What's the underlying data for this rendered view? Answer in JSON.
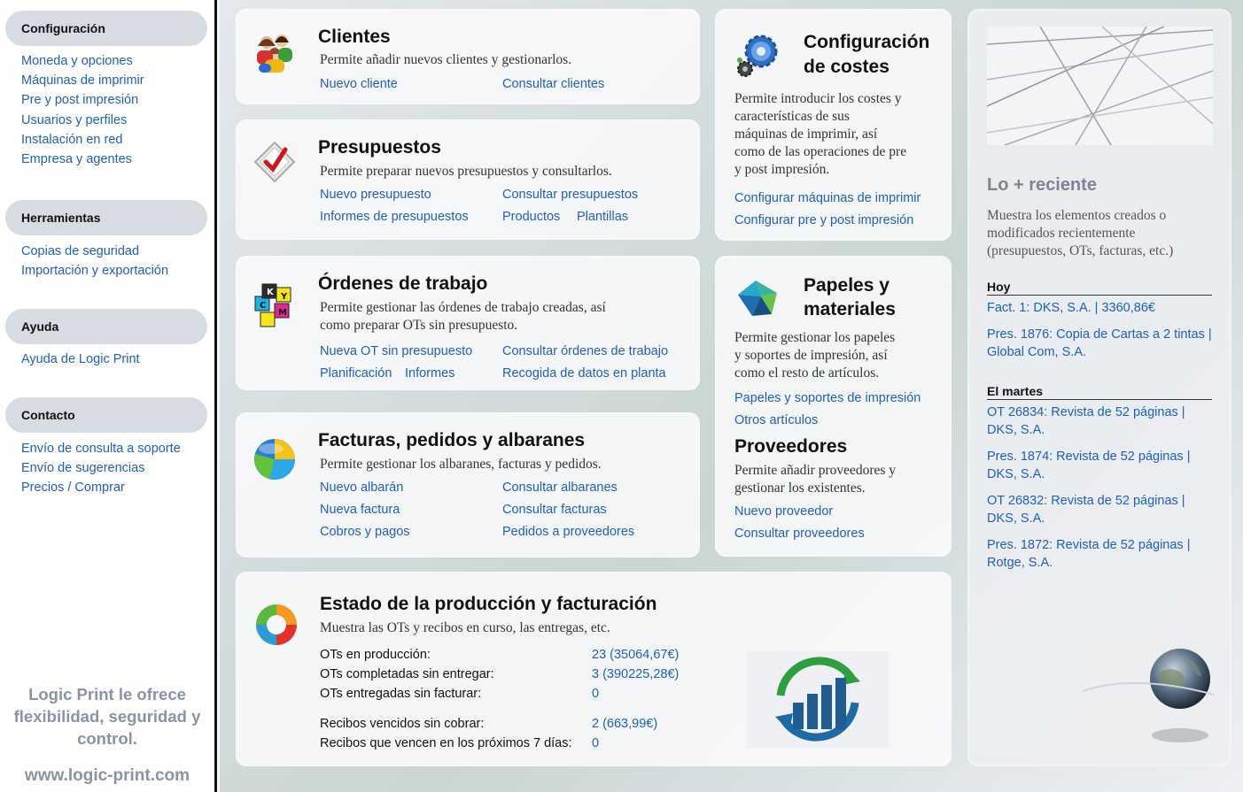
{
  "sidebar": {
    "sections": [
      {
        "title": "Configuración",
        "items": [
          "Moneda y opciones",
          "Máquinas de imprimir",
          "Pre y post impresión",
          "Usuarios y perfiles",
          "Instalación en red",
          "Empresa y agentes"
        ]
      },
      {
        "title": "Herramientas",
        "items": [
          "Copias de seguridad",
          "Importación y exportación"
        ]
      },
      {
        "title": "Ayuda",
        "items": [
          "Ayuda de Logic Print"
        ]
      },
      {
        "title": "Contacto",
        "items": [
          "Envío de consulta a soporte",
          "Envío de sugerencias",
          "Precios / Comprar"
        ]
      }
    ],
    "slogan_line1": "Logic Print le ofrece",
    "slogan_line2": "flexibilidad, seguridad y",
    "slogan_line3": "control.",
    "site_url": "www.logic-print.com"
  },
  "cards": {
    "clientes": {
      "title": "Clientes",
      "desc": "Permite añadir nuevos clientes y gestionarlos.",
      "links": [
        "Nuevo cliente",
        "Consultar clientes"
      ]
    },
    "presupuestos": {
      "title": "Presupuestos",
      "desc": "Permite preparar nuevos presupuestos y consultarlos.",
      "links": [
        "Nuevo presupuesto",
        "Consultar presupuestos",
        "Informes de presupuestos",
        "Productos",
        "Plantillas"
      ]
    },
    "ordenes": {
      "title": "Órdenes de trabajo",
      "desc_line1": "Permite gestionar las órdenes de trabajo creadas, así",
      "desc_line2": "como preparar OTs sin presupuesto.",
      "links": [
        "Nueva OT sin presupuesto",
        "Consultar órdenes de trabajo",
        "Planificación",
        "Informes",
        "Recogida de datos en planta"
      ]
    },
    "facturas": {
      "title": "Facturas, pedidos y albaranes",
      "desc": "Permite gestionar los albaranes, facturas y pedidos.",
      "links": [
        "Nuevo albarán",
        "Consultar albaranes",
        "Nueva factura",
        "Consultar facturas",
        "Cobros y pagos",
        "Pedidos a proveedores"
      ]
    },
    "costes": {
      "title_line1": "Configuración",
      "title_line2": "de costes",
      "desc_lines": [
        "Permite introducir los costes y",
        "características de sus",
        "máquinas de imprimir, así",
        "como de las operaciones de pre",
        "y post impresión."
      ],
      "links": [
        "Configurar máquinas de imprimir",
        "Configurar pre y post impresión"
      ]
    },
    "papeles": {
      "title_line1": "Papeles y",
      "title_line2": "materiales",
      "desc_lines": [
        "Permite gestionar los papeles",
        "y soportes de impresión, así",
        "como el resto de artículos."
      ],
      "links": [
        "Papeles y soportes de impresión",
        "Otros artículos"
      ]
    },
    "proveedores": {
      "title": "Proveedores",
      "desc_lines": [
        "Permite añadir proveedores y",
        "gestionar los existentes."
      ],
      "links": [
        "Nuevo proveedor",
        "Consultar proveedores"
      ]
    },
    "estado": {
      "title": "Estado de la producción y facturación",
      "desc": "Muestra las OTs y recibos en curso, las entregas, etc.",
      "stats": [
        {
          "label": "OTs en producción:",
          "value": "23 (35064,67€)"
        },
        {
          "label": "OTs completadas sin entregar:",
          "value": "3 (390225,28€)"
        },
        {
          "label": "OTs entregadas sin facturar:",
          "value": "0"
        },
        {
          "label": "Recibos vencidos sin cobrar:",
          "value": "2 (663,99€)"
        },
        {
          "label": "Recibos que vencen en los próximos 7 días:",
          "value": "0"
        }
      ]
    }
  },
  "recent": {
    "title": "Lo + reciente",
    "desc_lines": [
      "Muestra los elementos creados o",
      "modificados recientemente",
      "(presupuestos, OTs, facturas, etc.)"
    ],
    "today_label": "Hoy",
    "today_items": [
      "Fact. 1: DKS, S.A. | 3360,86€",
      "Pres. 1876: Copia de Cartas a 2 tintas | Global Com, S.A."
    ],
    "tuesday_label": "El martes",
    "tuesday_items": [
      "OT 26834: Revista de 52 páginas | DKS, S.A.",
      "Pres. 1874: Revista de 52 páginas | DKS, S.A.",
      "OT 26832: Revista de 52 páginas | DKS, S.A.",
      "Pres. 1872: Revista de 52 páginas | Rotge, S.A."
    ]
  },
  "colors": {
    "link": "#1f5fbf",
    "header_pill": "#d7dbe2",
    "slogan": "#8a93a6"
  }
}
